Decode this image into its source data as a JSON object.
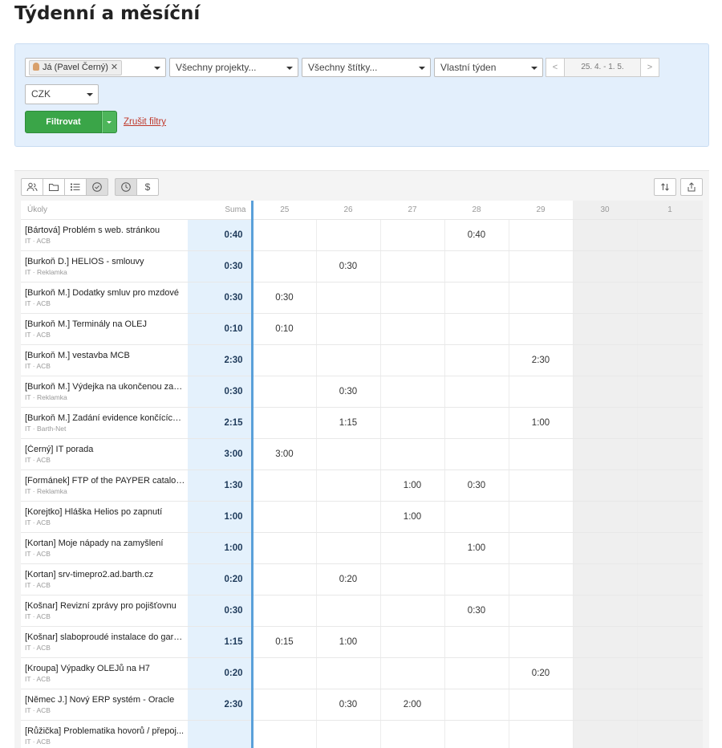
{
  "page": {
    "title": "Týdenní a měsíční"
  },
  "filters": {
    "user_chip": "Já (Pavel Černý)",
    "projects": "Všechny projekty...",
    "tags": "Všechny štítky...",
    "period": "Vlastní týden",
    "week_range": "25. 4. - 1. 5.",
    "prev": "<",
    "next": ">",
    "currency": "CZK",
    "filter_button": "Filtrovat",
    "clear_link": "Zrušit filtry"
  },
  "grid": {
    "task_header": "Úkoly",
    "sum_header": "Suma",
    "days": [
      "25",
      "26",
      "27",
      "28",
      "29",
      "30",
      "1"
    ],
    "rows": [
      {
        "title": "[Bártová] Problém s web. stránkou",
        "sub": "IT · ACB",
        "sum": "0:40",
        "cells": [
          "",
          "",
          "",
          "0:40",
          "",
          "",
          ""
        ]
      },
      {
        "title": "[Burkoň D.] HELIOS - smlouvy",
        "sub": "IT · Reklamka",
        "sum": "0:30",
        "cells": [
          "",
          "0:30",
          "",
          "",
          "",
          "",
          ""
        ]
      },
      {
        "title": "[Burkoň M.] Dodatky smluv pro mzdové",
        "sub": "IT · ACB",
        "sum": "0:30",
        "cells": [
          "0:30",
          "",
          "",
          "",
          "",
          "",
          ""
        ]
      },
      {
        "title": "[Burkoň M.] Terminály na OLEJ",
        "sub": "IT · ACB",
        "sum": "0:10",
        "cells": [
          "0:10",
          "",
          "",
          "",
          "",
          "",
          ""
        ]
      },
      {
        "title": "[Burkoň M.] vestavba MCB",
        "sub": "IT · ACB",
        "sum": "2:30",
        "cells": [
          "",
          "",
          "",
          "",
          "2:30",
          "",
          ""
        ]
      },
      {
        "title": "[Burkoň M.] Výdejka na ukončenou zaká...",
        "sub": "IT · Reklamka",
        "sum": "0:30",
        "cells": [
          "",
          "0:30",
          "",
          "",
          "",
          "",
          ""
        ]
      },
      {
        "title": "[Burkoň M.] Zadání evidence končících s...",
        "sub": "IT · Barth-Net",
        "sum": "2:15",
        "cells": [
          "",
          "1:15",
          "",
          "",
          "1:00",
          "",
          ""
        ]
      },
      {
        "title": "[Černý] IT porada",
        "sub": "IT · ACB",
        "sum": "3:00",
        "cells": [
          "3:00",
          "",
          "",
          "",
          "",
          "",
          ""
        ]
      },
      {
        "title": "[Formánek] FTP of the PAYPER catalogue",
        "sub": "IT · Reklamka",
        "sum": "1:30",
        "cells": [
          "",
          "",
          "1:00",
          "0:30",
          "",
          "",
          ""
        ]
      },
      {
        "title": "[Korejtko] Hláška Helios po zapnutí",
        "sub": "IT · ACB",
        "sum": "1:00",
        "cells": [
          "",
          "",
          "1:00",
          "",
          "",
          "",
          ""
        ]
      },
      {
        "title": "[Kortan] Moje nápady na zamyšlení",
        "sub": "IT · ACB",
        "sum": "1:00",
        "cells": [
          "",
          "",
          "",
          "1:00",
          "",
          "",
          ""
        ]
      },
      {
        "title": "[Kortan] srv-timepro2.ad.barth.cz",
        "sub": "IT · ACB",
        "sum": "0:20",
        "cells": [
          "",
          "0:20",
          "",
          "",
          "",
          "",
          ""
        ]
      },
      {
        "title": "[Košnar] Revizní zprávy pro pojišťovnu",
        "sub": "IT · ACB",
        "sum": "0:30",
        "cells": [
          "",
          "",
          "",
          "0:30",
          "",
          "",
          ""
        ]
      },
      {
        "title": "[Košnar] slaboproudé instalace do garáž...",
        "sub": "IT · ACB",
        "sum": "1:15",
        "cells": [
          "0:15",
          "1:00",
          "",
          "",
          "",
          "",
          ""
        ]
      },
      {
        "title": "[Kroupa] Výpadky OLEJů na H7",
        "sub": "IT · ACB",
        "sum": "0:20",
        "cells": [
          "",
          "",
          "",
          "",
          "0:20",
          "",
          ""
        ]
      },
      {
        "title": "[Němec J.] Nový ERP systém - Oracle",
        "sub": "IT · ACB",
        "sum": "2:30",
        "cells": [
          "",
          "0:30",
          "2:00",
          "",
          "",
          "",
          ""
        ]
      },
      {
        "title": "[Růžička] Problematika hovorů / přepoj...",
        "sub": "IT · ACB",
        "sum": "",
        "cells": [
          "",
          "",
          "",
          "",
          "",
          "",
          ""
        ]
      }
    ]
  },
  "toolbar": {
    "left_icons": [
      "users-icon",
      "folder-icon",
      "list-icon",
      "check-circle-icon"
    ],
    "right_icons": [
      "clock-icon",
      "dollar-icon"
    ],
    "end_icons": [
      "sort-icon",
      "export-icon"
    ],
    "dollar_glyph": "$"
  }
}
